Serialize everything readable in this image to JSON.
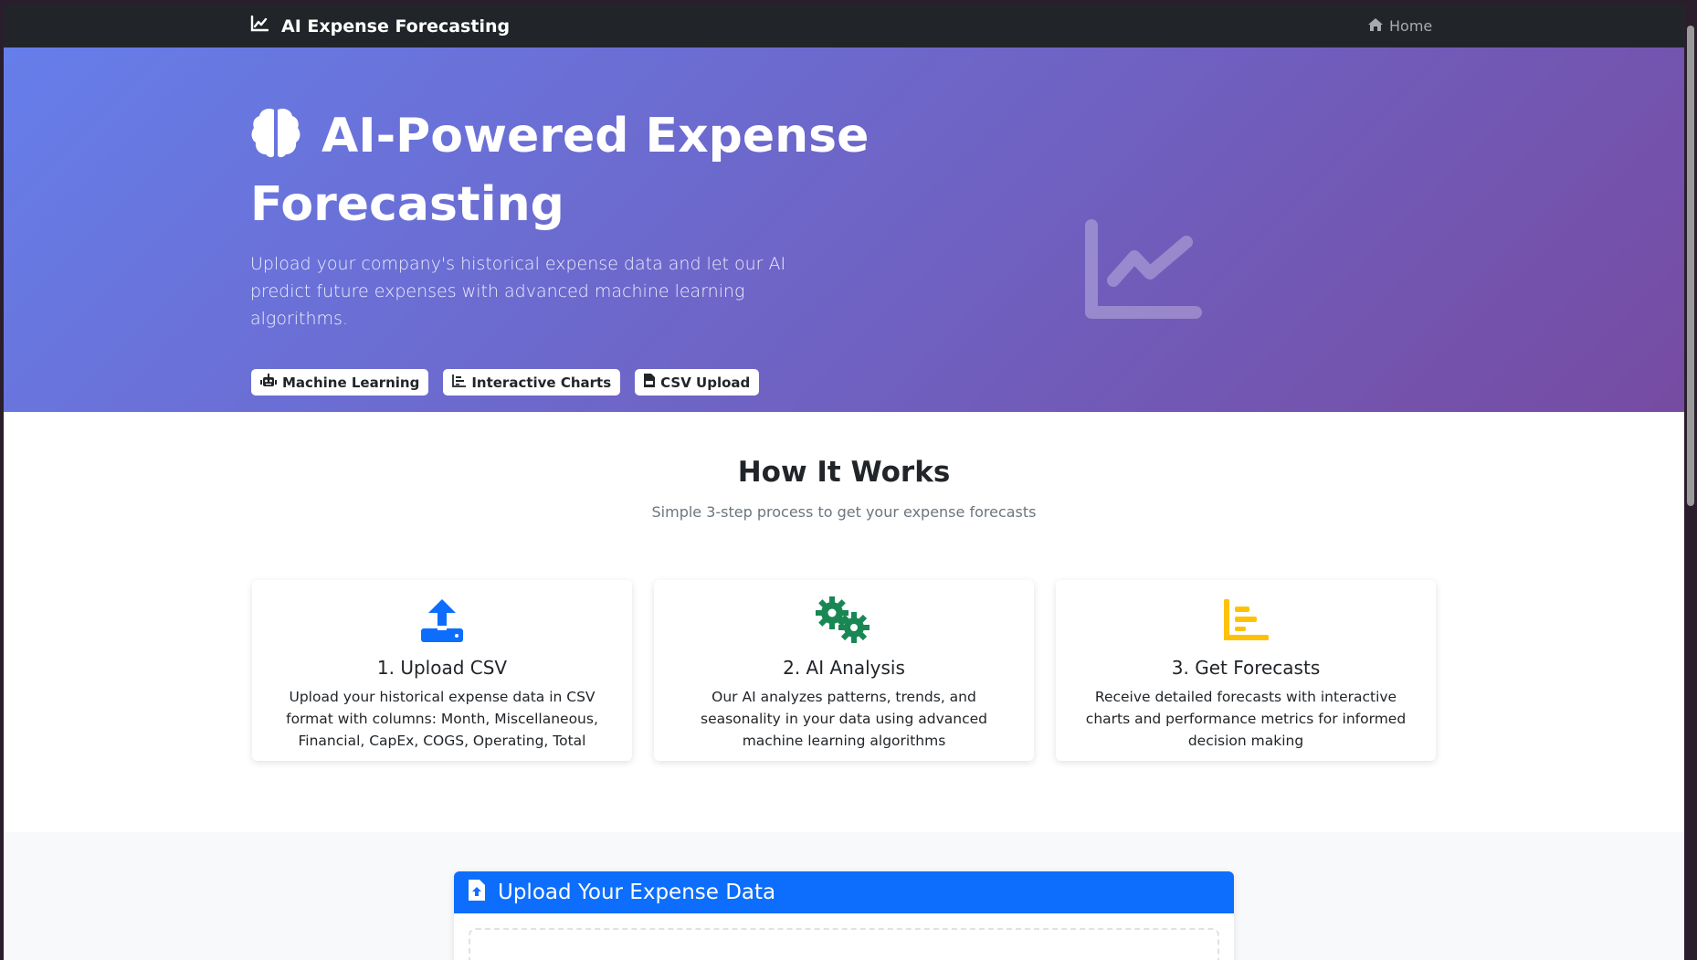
{
  "navbar": {
    "brand": "AI Expense Forecasting",
    "brand_icon": "chart-line-icon",
    "home_label": "Home",
    "home_icon": "home-icon"
  },
  "hero": {
    "title": "AI-Powered Expense Forecasting",
    "title_icon": "brain-icon",
    "lead": "Upload your company's historical expense data and let our AI predict future expenses with advanced machine learning algorithms.",
    "badges": [
      {
        "icon": "robot-icon",
        "label": "Machine Learning"
      },
      {
        "icon": "chart-bar-icon",
        "label": "Interactive Charts"
      },
      {
        "icon": "csv-file-icon",
        "label": "CSV Upload"
      }
    ],
    "illustration_icon": "chart-line-icon"
  },
  "how_it_works": {
    "title": "How It Works",
    "subtitle": "Simple 3-step process to get your expense forecasts",
    "steps": [
      {
        "icon": "upload-icon",
        "title": "1. Upload CSV",
        "text": "Upload your historical expense data in CSV format with columns: Month, Miscellaneous, Financial, CapEx, COGS, Operating, Total"
      },
      {
        "icon": "gears-icon",
        "title": "2. AI Analysis",
        "text": "Our AI analyzes patterns, trends, and seasonality in your data using advanced machine learning algorithms"
      },
      {
        "icon": "chart-bar-icon",
        "title": "3. Get Forecasts",
        "text": "Receive detailed forecasts with interactive charts and performance metrics for informed decision making"
      }
    ]
  },
  "upload": {
    "title": "Upload Your Expense Data",
    "icon": "file-upload-icon"
  },
  "colors": {
    "navbar": "#212529",
    "hero_start": "#667eea",
    "hero_end": "#764ba2",
    "primary": "#0d6efd",
    "success": "#198754",
    "warning": "#ffc107"
  }
}
